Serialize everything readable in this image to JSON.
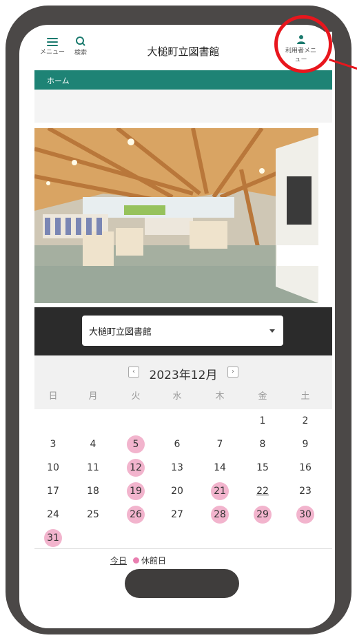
{
  "header": {
    "menu_label": "メニュー",
    "search_label": "検索",
    "title": "大槌町立図書館",
    "user_menu_label_line1": "利用者メニ",
    "user_menu_label_line2": "ュー"
  },
  "nav": {
    "home": "ホーム"
  },
  "library_select": {
    "selected": "大槌町立図書館"
  },
  "calendar": {
    "month_label": "2023年12月",
    "prev_icon": "‹",
    "next_icon": "›",
    "weekdays": [
      "日",
      "月",
      "火",
      "水",
      "木",
      "金",
      "土"
    ],
    "weeks": [
      [
        "",
        "",
        "",
        "",
        "",
        "1",
        "2"
      ],
      [
        "3",
        "4",
        "5",
        "6",
        "7",
        "8",
        "9"
      ],
      [
        "10",
        "11",
        "12",
        "13",
        "14",
        "15",
        "16"
      ],
      [
        "17",
        "18",
        "19",
        "20",
        "21",
        "22",
        "23"
      ],
      [
        "24",
        "25",
        "26",
        "27",
        "28",
        "29",
        "30"
      ],
      [
        "31",
        "",
        "",
        "",
        "",
        "",
        ""
      ]
    ],
    "closed_days": [
      "5",
      "12",
      "19",
      "21",
      "26",
      "28",
      "29",
      "30",
      "31"
    ],
    "today": "22"
  },
  "legend": {
    "today": "今日",
    "closed": "休館日"
  },
  "colors": {
    "accent": "#1e8375",
    "closed": "#f2b4cd",
    "annotation": "#e8161d",
    "frame": "#4b4847"
  }
}
